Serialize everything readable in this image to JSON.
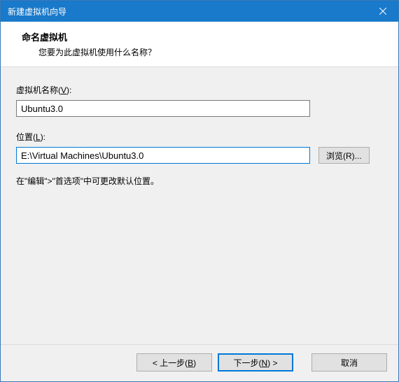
{
  "window": {
    "title": "新建虚拟机向导"
  },
  "header": {
    "title": "命名虚拟机",
    "subtitle": "您要为此虚拟机使用什么名称？"
  },
  "fields": {
    "name": {
      "label_prefix": "虚拟机名称(",
      "label_key": "V",
      "label_suffix": "):",
      "value": "Ubuntu3.0"
    },
    "location": {
      "label_prefix": "位置(",
      "label_key": "L",
      "label_suffix": "):",
      "value": "E:\\Virtual Machines\\Ubuntu3.0"
    },
    "browse": {
      "label_prefix": "浏览(",
      "label_key": "R",
      "label_suffix": ")..."
    }
  },
  "hint": "在\"编辑\">\"首选项\"中可更改默认位置。",
  "footer": {
    "back": {
      "prefix": "< 上一步(",
      "key": "B",
      "suffix": ")"
    },
    "next": {
      "prefix": "下一步(",
      "key": "N",
      "suffix": ") >"
    },
    "cancel": "取消"
  }
}
